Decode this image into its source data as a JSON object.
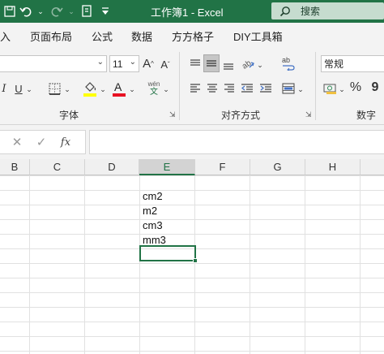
{
  "title_bar": {
    "doc_title": "工作簿1  -  Excel",
    "search_placeholder": "搜索",
    "icons": [
      "undo-icon",
      "redo-icon",
      "touch-mode-icon",
      "customize-qat-icon",
      "search-icon"
    ]
  },
  "tabs": [
    "入",
    "页面布局",
    "公式",
    "数据",
    "方方格子",
    "DIY工具箱"
  ],
  "ribbon": {
    "font_group": {
      "font_size": "11",
      "label": "字体",
      "grow_font": "A",
      "shrink_font": "A",
      "italic": "I",
      "underline": "U",
      "phonetic": "wén",
      "phonetic_sub": "文"
    },
    "alignment_group": {
      "label": "对齐方式"
    },
    "number_group": {
      "format": "常规",
      "percent": "%",
      "comma": "9",
      "label": "数字"
    }
  },
  "formula_bar": {
    "cancel": "✕",
    "enter": "✓",
    "fx": "fx",
    "value": ""
  },
  "sheet": {
    "columns": [
      "B",
      "C",
      "D",
      "E",
      "F",
      "G",
      "H"
    ],
    "active_column": "E",
    "cells": [
      "cm2",
      "m2",
      "cm3",
      "mm3"
    ],
    "accent_color": "#217346"
  }
}
